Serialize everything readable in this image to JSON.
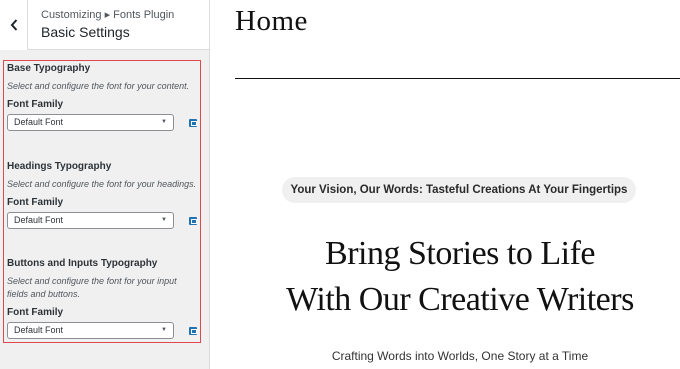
{
  "panel": {
    "breadcrumb": "Customizing ▸ Fonts Plugin",
    "title": "Basic Settings"
  },
  "sections": [
    {
      "title": "Base Typography",
      "description": "Select and configure the font for your content.",
      "field_label": "Font Family",
      "value": "Default Font"
    },
    {
      "title": "Headings Typography",
      "description": "Select and configure the font for your headings.",
      "field_label": "Font Family",
      "value": "Default Font"
    },
    {
      "title": "Buttons and Inputs Typography",
      "description": "Select and configure the font for your input fields and buttons.",
      "field_label": "Font Family",
      "value": "Default Font"
    }
  ],
  "preview": {
    "site_title": "Home",
    "tagline_pill": "Your Vision, Our Words: Tasteful Creations At Your Fingertips",
    "headline_line1": "Bring Stories to Life",
    "headline_line2": "With Our Creative Writers",
    "subtitle": "Crafting Words into Worlds, One Story at a Time"
  },
  "colors": {
    "highlight_border": "#e0484f",
    "accent": "#2271b1",
    "panel_bg": "#f0f0f1"
  }
}
